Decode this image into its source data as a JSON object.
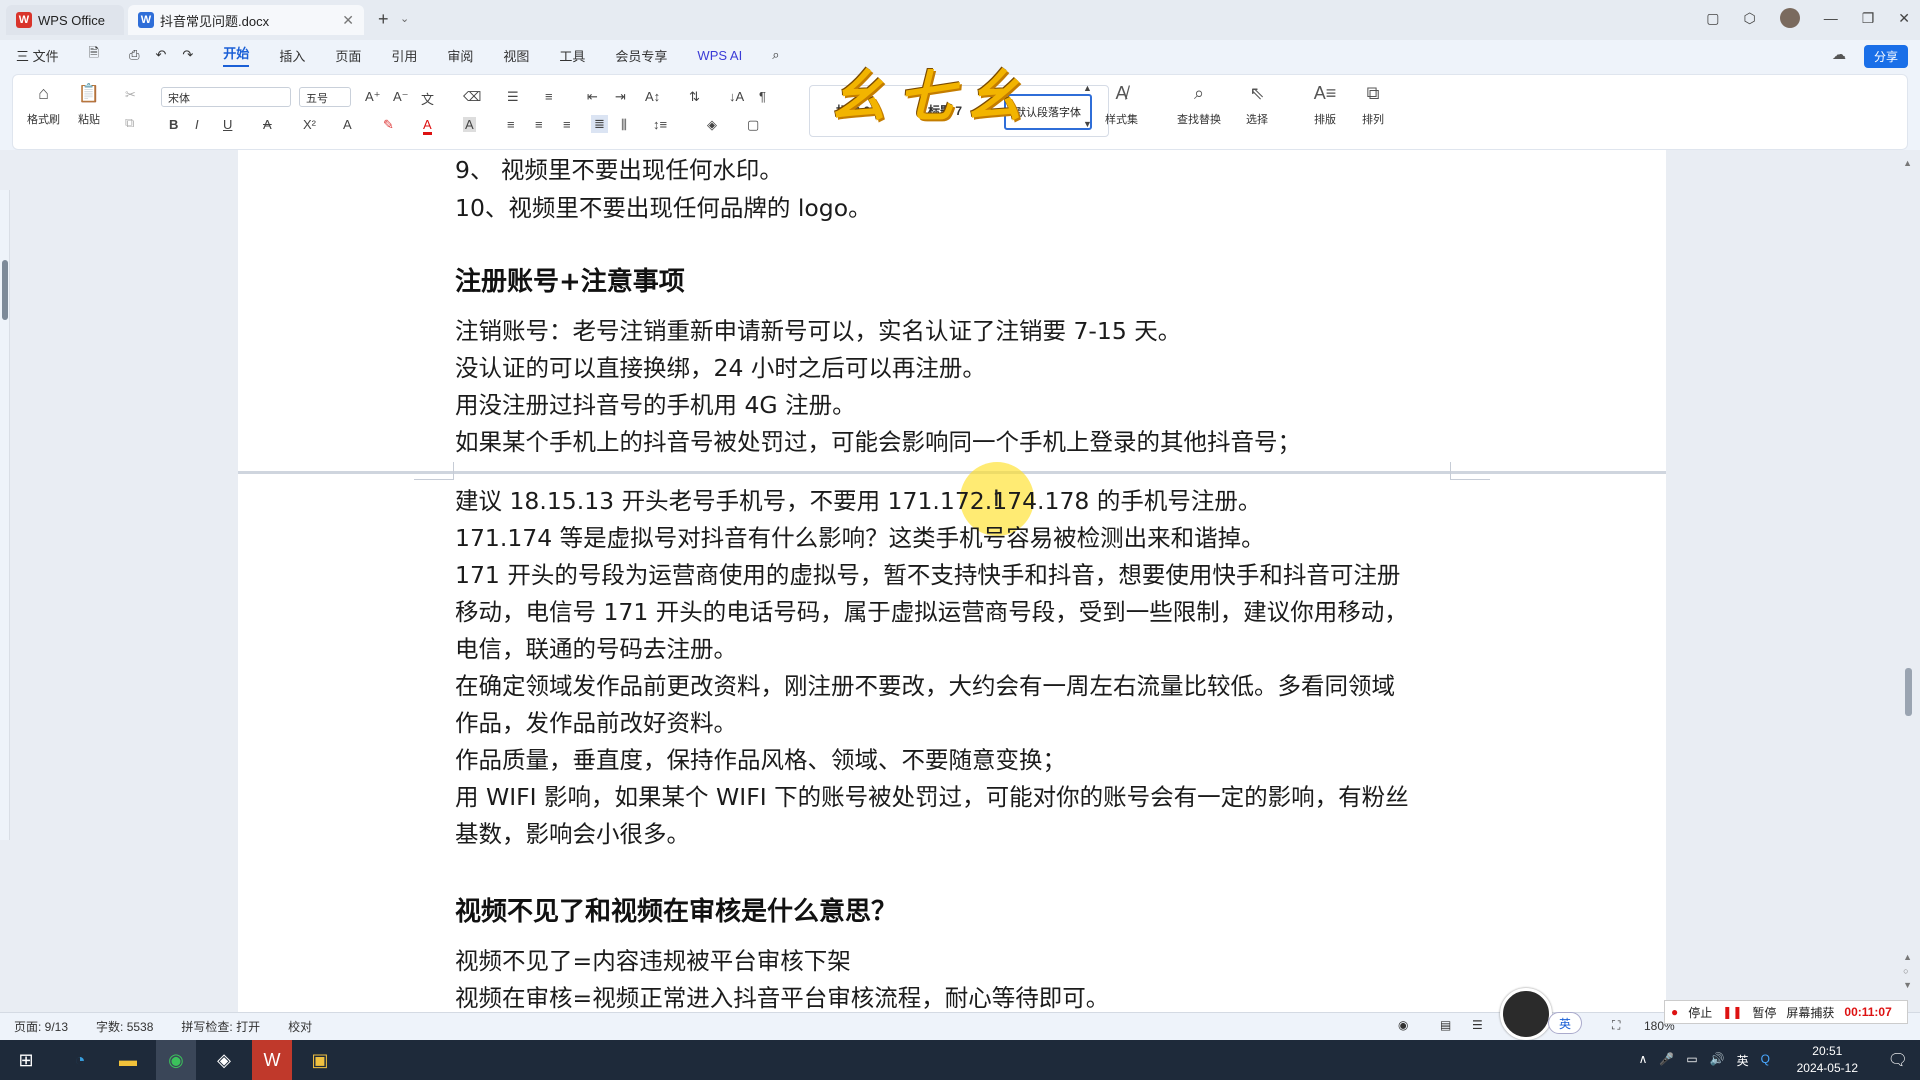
{
  "titlebar": {
    "tabs": [
      {
        "label": "WPS Office",
        "icon": "wps-logo-icon",
        "color": "#d9342b"
      },
      {
        "label": "抖音常见问题.docx",
        "icon": "word-doc-icon",
        "color": "#2f6ed8"
      }
    ],
    "new_tab": "+"
  },
  "menubar": {
    "file": "三 文件",
    "items": [
      "开始",
      "插入",
      "页面",
      "引用",
      "审阅",
      "视图",
      "工具",
      "会员专享"
    ],
    "active": "开始",
    "wps_ai": "WPS AI",
    "share": "分享"
  },
  "ribbon": {
    "format_painter": "格式刷",
    "paste": "粘贴",
    "font_name": "宋体",
    "font_size": "五号",
    "styles": [
      "标题 6",
      "标题 7",
      "默认段落字体"
    ],
    "style_set": "样式集",
    "find_replace": "查找替换",
    "select": "选择",
    "layout": "排版",
    "arrange": "排列"
  },
  "watermark": "幺七幺",
  "document": {
    "page1": [
      {
        "type": "p",
        "text": "9、  视频里不要出现任何水印。"
      },
      {
        "type": "p",
        "text": "10、视频里不要出现任何品牌的  logo。"
      },
      {
        "type": "h",
        "text": "注册账号+注意事项"
      },
      {
        "type": "p",
        "text": "注销账号：老号注销重新申请新号可以，实名认证了注销要 7-15 天。"
      },
      {
        "type": "p",
        "text": "没认证的可以直接换绑，24 小时之后可以再注册。"
      },
      {
        "type": "p",
        "text": "用没注册过抖音号的手机用 4G 注册。"
      },
      {
        "type": "p",
        "text": "如果某个手机上的抖音号被处罚过，可能会影响同一个手机上登录的其他抖音号；"
      }
    ],
    "page2": [
      {
        "type": "p",
        "text": "建议 18.15.13 开头老号手机号，不要用 171.172.174.178 的手机号注册。"
      },
      {
        "type": "p",
        "text": "171.174 等是虚拟号对抖音有什么影响？这类手机号容易被检测出来和谐掉。"
      },
      {
        "type": "p",
        "text": "171 开头的号段为运营商使用的虚拟号，暂不支持快手和抖音，想要使用快手和抖音可注册"
      },
      {
        "type": "p",
        "text": "移动，电信号 171 开头的电话号码，属于虚拟运营商号段，受到一些限制，建议你用移动，"
      },
      {
        "type": "p",
        "text": "电信，联通的号码去注册。"
      },
      {
        "type": "p",
        "text": "在确定领域发作品前更改资料，刚注册不要改，大约会有一周左右流量比较低。多看同领域"
      },
      {
        "type": "p",
        "text": "作品，发作品前改好资料。"
      },
      {
        "type": "p",
        "text": "作品质量，垂直度，保持作品风格、领域、不要随意变换；"
      },
      {
        "type": "p",
        "text": "用 WIFI 影响，如果某个 WIFI 下的账号被处罚过，可能对你的账号会有一定的影响，有粉丝"
      },
      {
        "type": "p",
        "text": "基数，影响会小很多。"
      },
      {
        "type": "h",
        "text": "视频不见了和视频在审核是什么意思？"
      },
      {
        "type": "p",
        "text": "视频不见了=内容违规被平台审核下架"
      },
      {
        "type": "p",
        "text": "视频在审核=视频正常进入抖音平台审核流程，耐心等待即可。"
      }
    ]
  },
  "statusbar": {
    "page": "页面: 9/13",
    "words": "字数: 5538",
    "spell": "拼写检查: 打开",
    "proof": "校对",
    "zoom": "180%"
  },
  "recorder": {
    "stop": "停止",
    "pause": "暂停",
    "capture": "屏幕捕获",
    "time": "00:11:07"
  },
  "ime": "英",
  "taskbar": {
    "ime": "英",
    "time": "20:51",
    "date": "2024-05-12"
  }
}
